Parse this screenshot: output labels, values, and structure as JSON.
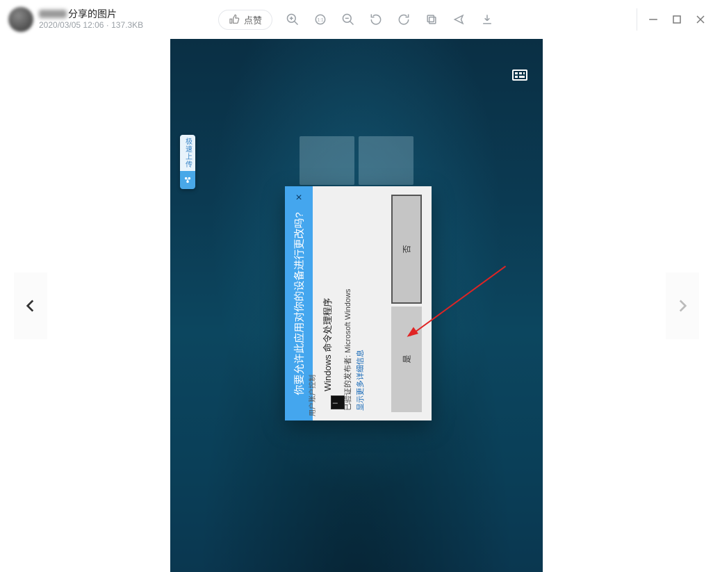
{
  "header": {
    "title_suffix": "分享的图片",
    "timestamp": "2020/03/05 12:06",
    "filesize": "137.3KB",
    "like_label": "点赞"
  },
  "uac": {
    "small_title": "用户账户控制",
    "title": "你要允许此应用对你的设备进行更改吗?",
    "app_name": "Windows 命令处理程序",
    "publisher": "已验证的发布者: Microsoft Windows",
    "show_details": "显示更多详细信息",
    "yes": "是",
    "no": "否"
  },
  "side_widget_label": "极速上传"
}
